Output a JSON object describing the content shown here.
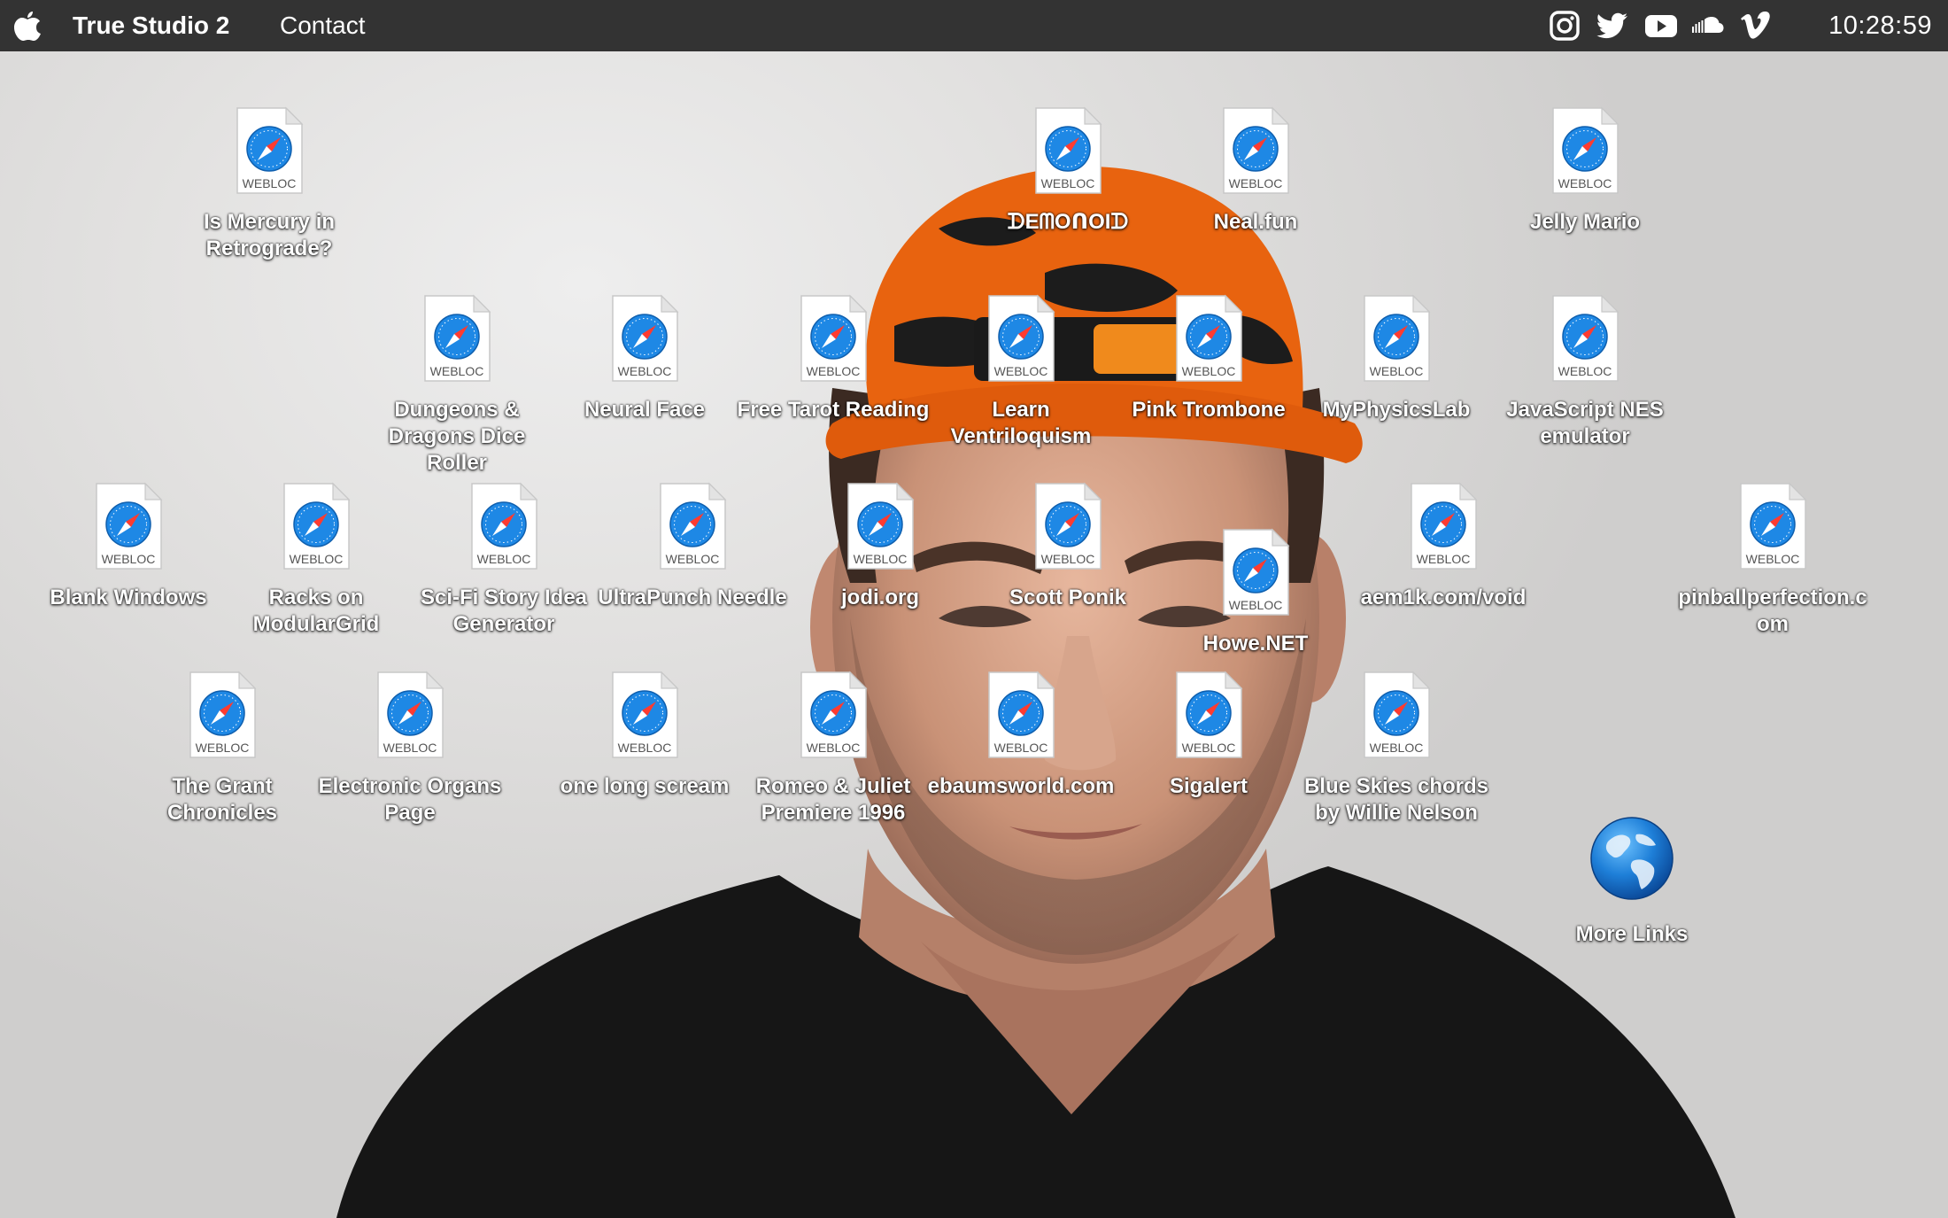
{
  "menubar": {
    "app_name": "True Studio 2",
    "menu_items": [
      "Contact"
    ],
    "social_icons": [
      "instagram-icon",
      "twitter-icon",
      "youtube-icon",
      "soundcloud-icon",
      "vimeo-icon"
    ],
    "clock": "10:28:59"
  },
  "desktop": {
    "file_badge": "WEBLOC",
    "icons": [
      {
        "label": "Is Mercury in Retrograde?",
        "type": "webloc"
      },
      {
        "label": "ᗪEᗰOᑎOIᗪ",
        "type": "webloc"
      },
      {
        "label": "Neal.fun",
        "type": "webloc"
      },
      {
        "label": "Jelly Mario",
        "type": "webloc"
      },
      {
        "label": "Dungeons & Dragons Dice Roller",
        "type": "webloc"
      },
      {
        "label": "Neural Face",
        "type": "webloc"
      },
      {
        "label": "Free Tarot Reading",
        "type": "webloc"
      },
      {
        "label": "Learn Ventriloquism",
        "type": "webloc"
      },
      {
        "label": "Pink Trombone",
        "type": "webloc"
      },
      {
        "label": "MyPhysicsLab",
        "type": "webloc"
      },
      {
        "label": "JavaScript NES emulator",
        "type": "webloc"
      },
      {
        "label": "Blank Windows",
        "type": "webloc"
      },
      {
        "label": "Racks on ModularGrid",
        "type": "webloc"
      },
      {
        "label": "Sci-Fi Story Idea Generator",
        "type": "webloc"
      },
      {
        "label": "UltraPunch Needle",
        "type": "webloc"
      },
      {
        "label": "jodi.org",
        "type": "webloc"
      },
      {
        "label": "Scott Ponik",
        "type": "webloc"
      },
      {
        "label": "Howe.NET",
        "type": "webloc"
      },
      {
        "label": "aem1k.com/void",
        "type": "webloc"
      },
      {
        "label": "pinballperfection.com",
        "type": "webloc"
      },
      {
        "label": "The Grant Chronicles",
        "type": "webloc"
      },
      {
        "label": "Electronic Organs Page",
        "type": "webloc"
      },
      {
        "label": "one long scream",
        "type": "webloc"
      },
      {
        "label": "Romeo & Juliet Premiere 1996",
        "type": "webloc"
      },
      {
        "label": "ebaumsworld.com",
        "type": "webloc"
      },
      {
        "label": "Sigalert",
        "type": "webloc"
      },
      {
        "label": "Blue Skies chords by Willie Nelson",
        "type": "webloc"
      },
      {
        "label": "More Links",
        "type": "globe"
      }
    ]
  },
  "colors": {
    "menubar": "#333333",
    "hat_orange": "#e8630f",
    "shirt": "#161616",
    "safari_blue": "#1e88e5"
  }
}
